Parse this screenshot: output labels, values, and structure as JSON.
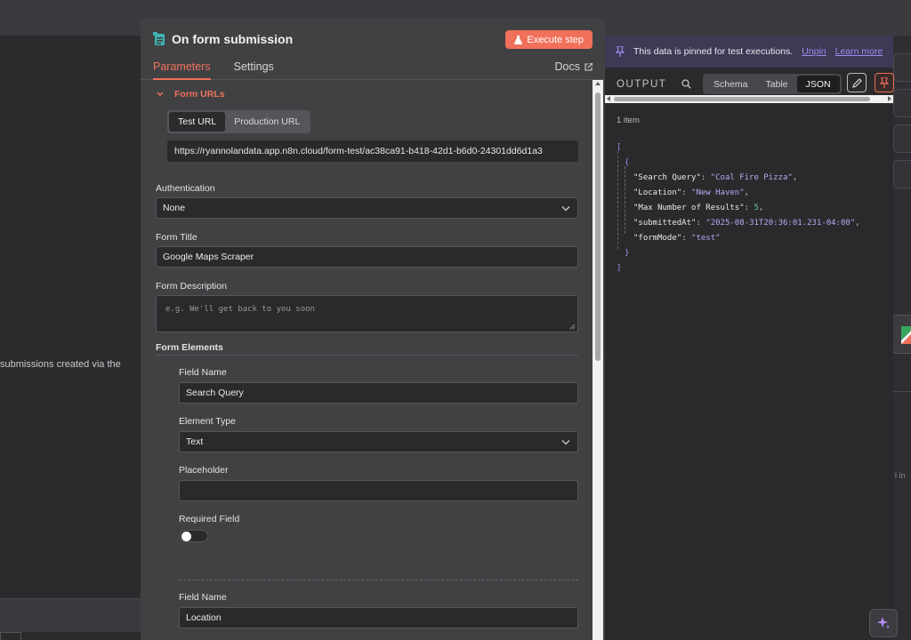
{
  "background": {
    "left_text": "submissions created via the",
    "right_small": "l in"
  },
  "panel": {
    "title": "On form submission",
    "execute_label": "Execute step",
    "tabs": [
      {
        "label": "Parameters",
        "active": true
      },
      {
        "label": "Settings",
        "active": false
      }
    ],
    "docs_label": "Docs",
    "form_urls": {
      "heading": "Form URLs",
      "url_tabs": [
        {
          "label": "Test URL",
          "active": true
        },
        {
          "label": "Production URL",
          "active": false
        }
      ],
      "url": "https://ryannolandata.app.n8n.cloud/form-test/ac38ca91-b418-42d1-b6d0-24301dd6d1a3"
    },
    "authentication": {
      "label": "Authentication",
      "value": "None"
    },
    "form_title": {
      "label": "Form Title",
      "value": "Google Maps Scraper"
    },
    "form_description": {
      "label": "Form Description",
      "placeholder": "e.g. We'll get back to you soon",
      "value": ""
    },
    "form_elements_label": "Form Elements",
    "elements": [
      {
        "field_name_label": "Field Name",
        "field_name": "Search Query",
        "element_type_label": "Element Type",
        "element_type": "Text",
        "placeholder_label": "Placeholder",
        "placeholder_value": "",
        "required_label": "Required Field",
        "required": false
      },
      {
        "field_name_label": "Field Name",
        "field_name": "Location"
      }
    ]
  },
  "output": {
    "pin_message": "This data is pinned for test executions.",
    "unpin_label": "Unpin",
    "learn_more_label": "Learn more",
    "title": "OUTPUT",
    "views": [
      {
        "label": "Schema",
        "active": false
      },
      {
        "label": "Table",
        "active": false
      },
      {
        "label": "JSON",
        "active": true
      }
    ],
    "item_count": "1 item",
    "json": {
      "open_array": "[",
      "open_obj": "{",
      "close_obj": "}",
      "close_array": "]",
      "entries": [
        {
          "key": "\"Search Query\"",
          "value": "\"Coal Fire Pizza\"",
          "type": "string"
        },
        {
          "key": "\"Location\"",
          "value": "\"New Haven\"",
          "type": "string"
        },
        {
          "key": "\"Max Number of Results\"",
          "value": "5",
          "type": "number"
        },
        {
          "key": "\"submittedAt\"",
          "value": "\"2025-08-31T20:36:01.231-04:00\"",
          "type": "string"
        },
        {
          "key": "\"formMode\"",
          "value": "\"test\"",
          "type": "string"
        }
      ]
    }
  },
  "colors": {
    "accent": "#f0705a",
    "link": "#9d8cf0",
    "node_icon": "#3fb4b0"
  }
}
